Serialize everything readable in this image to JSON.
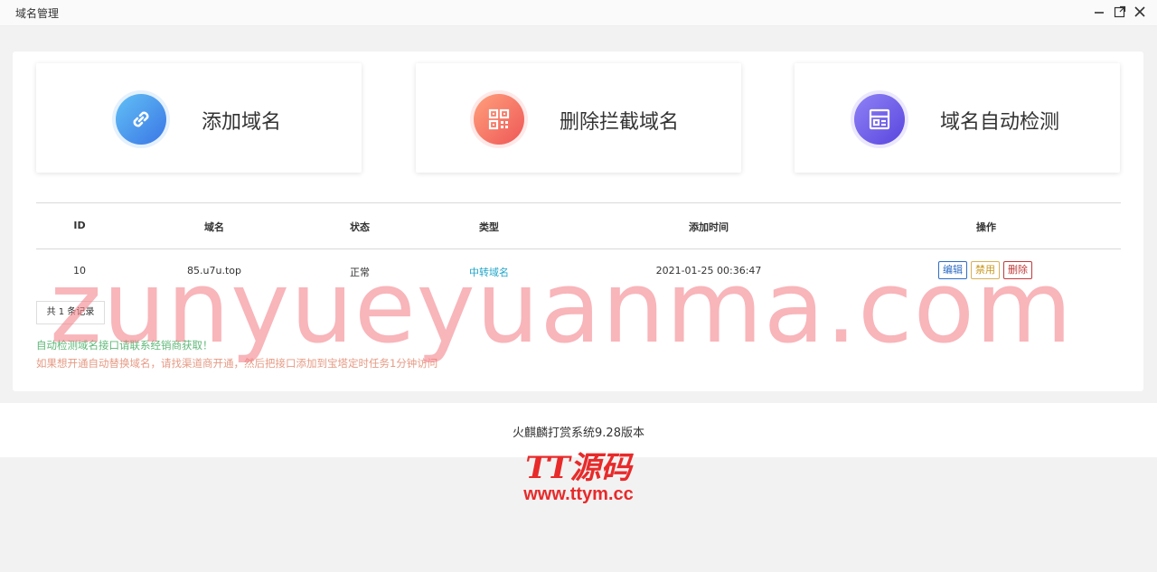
{
  "window": {
    "title": "域名管理"
  },
  "cards": [
    {
      "label": "添加域名",
      "icon": "link-icon",
      "color_start": "#5bb6f2",
      "color_end": "#3a78e8"
    },
    {
      "label": "删除拦截域名",
      "icon": "qrcode-icon",
      "color_start": "#ff9a7a",
      "color_end": "#f05a5a"
    },
    {
      "label": "域名自动检测",
      "icon": "list-layout-icon",
      "color_start": "#8b7df5",
      "color_end": "#5a4be0"
    }
  ],
  "table": {
    "headers": [
      "ID",
      "域名",
      "状态",
      "类型",
      "添加时间",
      "操作"
    ],
    "rows": [
      {
        "id": "10",
        "domain": "85.u7u.top",
        "status": "正常",
        "type": "中转域名",
        "added": "2021-01-25 00:36:47"
      }
    ],
    "actions": {
      "edit": "编辑",
      "disable": "禁用",
      "delete": "删除"
    },
    "type_color": "#1fa5c9"
  },
  "pagination": {
    "count_text": "共 1 条记录"
  },
  "notices": {
    "line1": "自动检测域名接口请联系经销商获取！",
    "line2": "如果想开通自动替换域名，请找渠道商开通，然后把接口添加到宝塔定时任务1分钟访问"
  },
  "footer": {
    "version": "火麒麟打赏系统9.28版本"
  },
  "watermarks": {
    "main": "zunyueyuanma.com",
    "logo": "TT源码",
    "url": "www.ttym.cc"
  }
}
